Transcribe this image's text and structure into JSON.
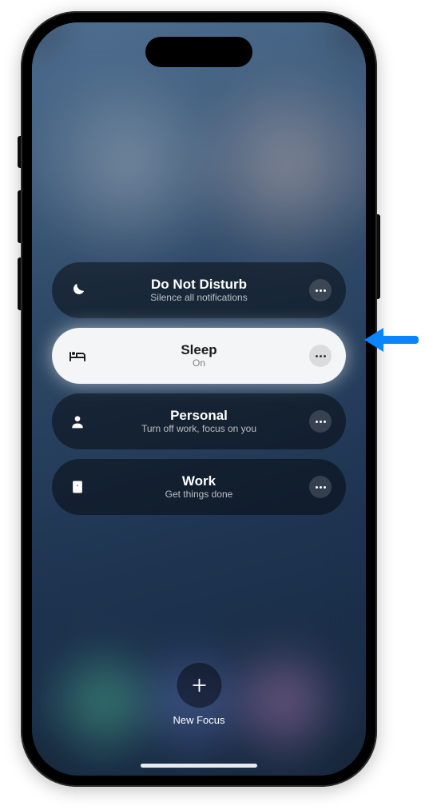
{
  "focus": {
    "items": [
      {
        "id": "dnd",
        "icon": "moon-icon",
        "title": "Do Not Disturb",
        "subtitle": "Silence all notifications",
        "active": false
      },
      {
        "id": "sleep",
        "icon": "bed-icon",
        "title": "Sleep",
        "subtitle": "On",
        "active": true
      },
      {
        "id": "personal",
        "icon": "person-icon",
        "title": "Personal",
        "subtitle": "Turn off work, focus on you",
        "active": false
      },
      {
        "id": "work",
        "icon": "badge-icon",
        "title": "Work",
        "subtitle": "Get things done",
        "active": false
      }
    ]
  },
  "newFocus": {
    "label": "New Focus"
  },
  "colors": {
    "arrow": "#0a84ff",
    "pill_dark": "rgba(0,0,0,0.45)",
    "pill_light": "rgba(255,255,255,0.95)"
  }
}
